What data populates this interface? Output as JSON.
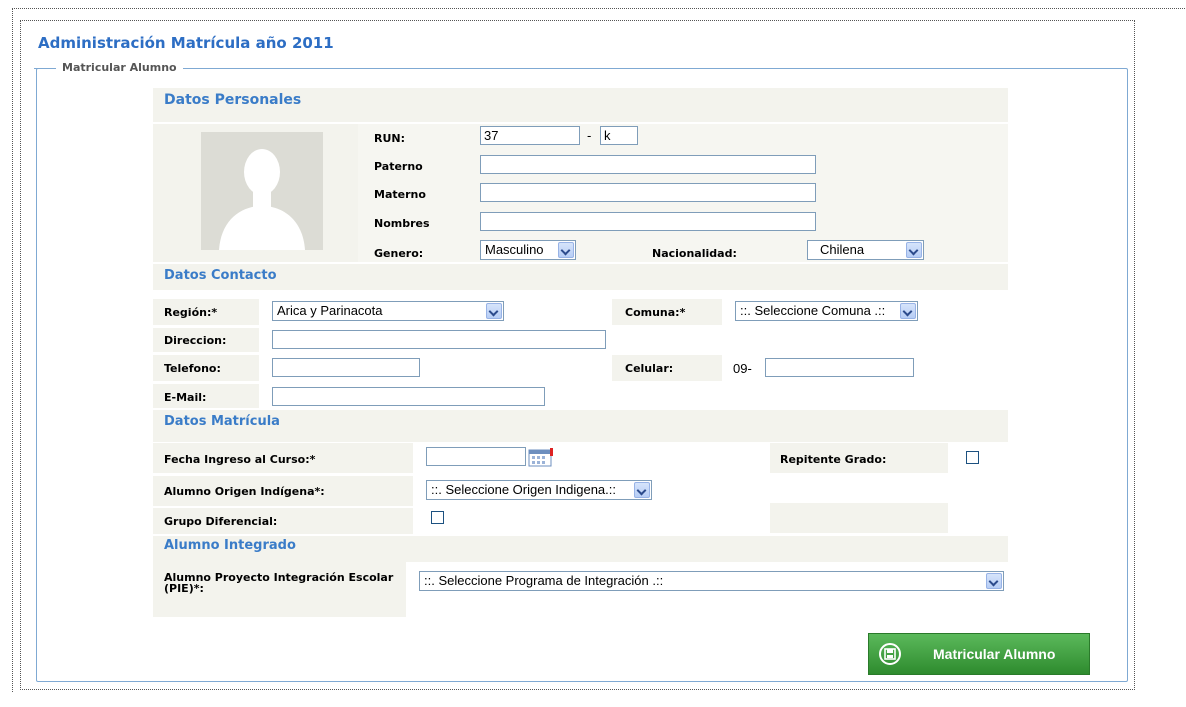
{
  "page": {
    "title": "Administración Matrícula año 2011"
  },
  "fieldset": {
    "legend": "Matricular Alumno"
  },
  "datos_personales": {
    "title": "Datos Personales",
    "run_label": "RUN:",
    "run_value": "37",
    "run_separator": "-",
    "run_dv": "k",
    "paterno_label": "Paterno",
    "paterno_value": "",
    "materno_label": "Materno",
    "materno_value": "",
    "nombres_label": "Nombres",
    "nombres_value": "",
    "genero_label": "Genero:",
    "genero_value": "Masculino",
    "nacionalidad_label": "Nacionalidad:",
    "nacionalidad_value": "Chilena"
  },
  "datos_contacto": {
    "title": "Datos Contacto",
    "region_label": "Región:*",
    "region_value": "Arica y Parinacota",
    "comuna_label": "Comuna:*",
    "comuna_value": "::. Seleccione Comuna .::",
    "direccion_label": "Direccion:",
    "telefono_label": "Telefono:",
    "celular_label": "Celular:",
    "celular_prefix": "09-",
    "email_label": "E-Mail:"
  },
  "datos_matricula": {
    "title": "Datos Matrícula",
    "fecha_label": "Fecha Ingreso al Curso:*",
    "repitente_label": "Repitente Grado:",
    "origen_label": "Alumno Origen Indígena*:",
    "origen_value": "::. Seleccione Origen Indigena.::",
    "grupo_label": "Grupo Diferencial:"
  },
  "alumno_integrado": {
    "title": "Alumno Integrado",
    "pie_label_line1": "Alumno Proyecto Integración Escolar",
    "pie_label_line2": "(PIE)*:",
    "pie_value": "::. Seleccione Programa de Integración .::"
  },
  "actions": {
    "submit_label": "Matricular Alumno"
  },
  "colors": {
    "title": "#2d6ec4",
    "section_title": "#3a7cc8",
    "band": "#f3f3ed",
    "button": "#3a9a3a"
  }
}
